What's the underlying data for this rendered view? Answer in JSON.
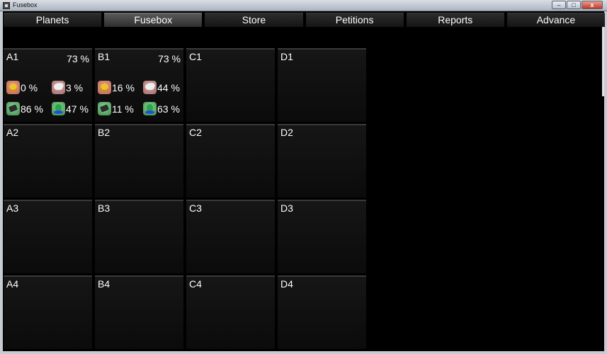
{
  "window": {
    "title": "Fusebox",
    "buttons": [
      "–",
      "□",
      "x"
    ]
  },
  "tabs": [
    {
      "label": "Planets",
      "active": false
    },
    {
      "label": "Fusebox",
      "active": true
    },
    {
      "label": "Store",
      "active": false
    },
    {
      "label": "Petitions",
      "active": false
    },
    {
      "label": "Reports",
      "active": false
    },
    {
      "label": "Advance",
      "active": false
    }
  ],
  "cells": {
    "A1": {
      "name": "A1",
      "percent": "73 %",
      "unhappiness": "0 %",
      "pollution": "3 %",
      "industry": "86 %",
      "farming": "47 %"
    },
    "B1": {
      "name": "B1",
      "percent": "73 %",
      "unhappiness": "16 %",
      "pollution": "44 %",
      "industry": "11 %",
      "farming": "63 %"
    },
    "C1": {
      "name": "C1"
    },
    "D1": {
      "name": "D1"
    },
    "A2": {
      "name": "A2"
    },
    "B2": {
      "name": "B2"
    },
    "C2": {
      "name": "C2"
    },
    "D2": {
      "name": "D2"
    },
    "A3": {
      "name": "A3"
    },
    "B3": {
      "name": "B3"
    },
    "C3": {
      "name": "C3"
    },
    "D3": {
      "name": "D3"
    },
    "A4": {
      "name": "A4"
    },
    "B4": {
      "name": "B4"
    },
    "C4": {
      "name": "C4"
    },
    "D4": {
      "name": "D4"
    }
  },
  "icons": {
    "unhappiness": "unhappy-face-icon",
    "pollution": "pollution-cloud-icon",
    "industry": "industry-icon",
    "farming": "farming-icon"
  }
}
